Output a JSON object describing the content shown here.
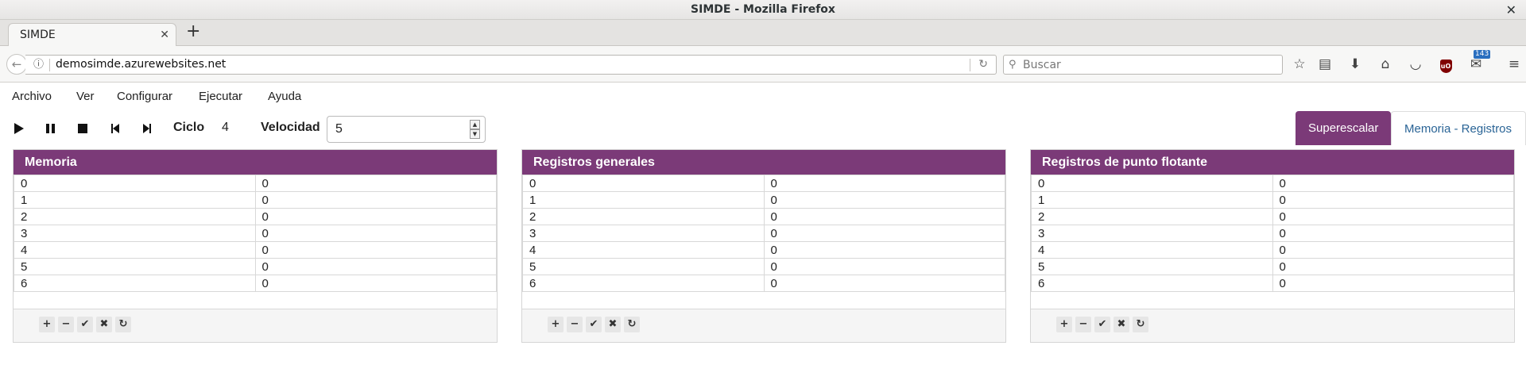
{
  "window": {
    "title": "SIMDE - Mozilla Firefox",
    "close": "✕"
  },
  "browser": {
    "tab_title": "SIMDE",
    "tab_close": "✕",
    "new_tab": "+",
    "url": "demosimde.azurewebsites.net",
    "search_placeholder": "Buscar",
    "notification_count": "143"
  },
  "app": {
    "menu": [
      "Archivo",
      "Ver",
      "Configurar",
      "Ejecutar",
      "Ayuda"
    ],
    "controls": {
      "cycle_label": "Ciclo",
      "cycle_value": "4",
      "speed_label": "Velocidad",
      "speed_value": "5"
    },
    "view_tabs": [
      "Superescalar",
      "Memoria - Registros"
    ],
    "active_view": "Superescalar",
    "panels": [
      {
        "title": "Memoria",
        "rows": [
          [
            "0",
            "0"
          ],
          [
            "1",
            "0"
          ],
          [
            "2",
            "0"
          ],
          [
            "3",
            "0"
          ],
          [
            "4",
            "0"
          ],
          [
            "5",
            "0"
          ],
          [
            "6",
            "0"
          ]
        ]
      },
      {
        "title": "Registros generales",
        "rows": [
          [
            "0",
            "0"
          ],
          [
            "1",
            "0"
          ],
          [
            "2",
            "0"
          ],
          [
            "3",
            "0"
          ],
          [
            "4",
            "0"
          ],
          [
            "5",
            "0"
          ],
          [
            "6",
            "0"
          ]
        ]
      },
      {
        "title": "Registros de punto flotante",
        "rows": [
          [
            "0",
            "0"
          ],
          [
            "1",
            "0"
          ],
          [
            "2",
            "0"
          ],
          [
            "3",
            "0"
          ],
          [
            "4",
            "0"
          ],
          [
            "5",
            "0"
          ],
          [
            "6",
            "0"
          ]
        ]
      }
    ],
    "panel_buttons": [
      "+",
      "−",
      "✔",
      "✖",
      "↻"
    ],
    "colors": {
      "accent": "#7b3a78",
      "link": "#2a6496"
    }
  }
}
